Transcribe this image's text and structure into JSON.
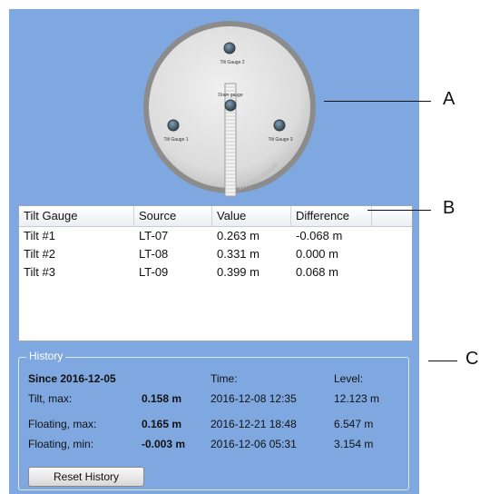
{
  "tank": {
    "gauges": [
      {
        "label": "Tilt Gauge 2"
      },
      {
        "label": "Drain gauge"
      },
      {
        "label": "Tilt Gauge 1"
      },
      {
        "label": "Tilt Gauge 3"
      }
    ]
  },
  "table": {
    "headers": [
      "Tilt Gauge",
      "Source",
      "Value",
      "Difference"
    ],
    "rows": [
      [
        "Tilt #1",
        "LT-07",
        "0.263 m",
        "-0.068 m"
      ],
      [
        "Tilt #2",
        "LT-08",
        "0.331 m",
        "0.000 m"
      ],
      [
        "Tilt #3",
        "LT-09",
        "0.399 m",
        "0.068 m"
      ]
    ]
  },
  "history": {
    "legend": "History",
    "since_label": "Since 2016-12-05",
    "time_header": "Time:",
    "level_header": "Level:",
    "rows": [
      {
        "label": "Tilt, max:",
        "value": "0.158 m",
        "time": "2016-12-08 12:35",
        "level": "12.123 m"
      },
      {
        "label": "Floating, max:",
        "value": "0.165 m",
        "time": "2016-12-21 18:48",
        "level": "6.547 m"
      },
      {
        "label": "Floating, min:",
        "value": "-0.003 m",
        "time": "2016-12-06 05:31",
        "level": "3.154 m"
      }
    ],
    "reset_button": "Reset History"
  },
  "callouts": [
    "A",
    "B",
    "C"
  ],
  "colors": {
    "panel_background": "#7fa8e0",
    "tank_rim": "#8c8c8c",
    "tank_face": "#d9d9d9"
  },
  "icons": [
    "gauge-icon",
    "drain-pipe-icon"
  ]
}
